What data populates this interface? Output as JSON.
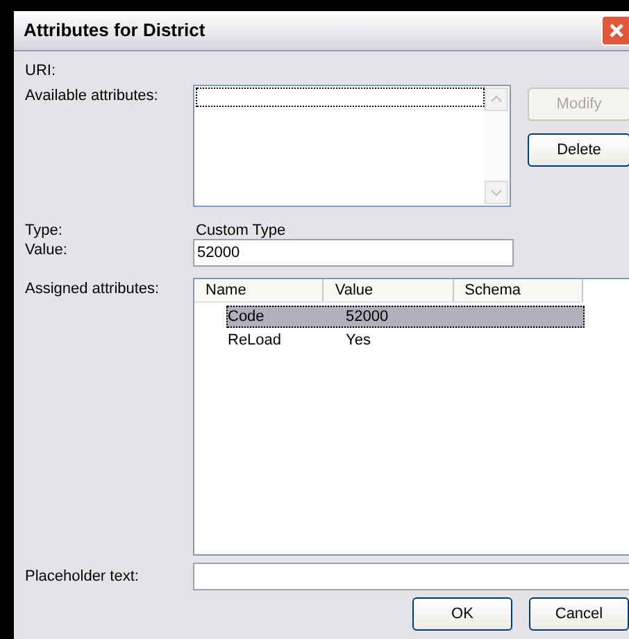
{
  "window": {
    "title": "Attributes for District"
  },
  "uri_label": "URI:",
  "available": {
    "label": "Available attributes:"
  },
  "side_buttons": [
    {
      "label": "Modify",
      "disabled": true
    },
    {
      "label": "Delete",
      "disabled": false
    }
  ],
  "type": {
    "label": "Type:",
    "value": "Custom Type"
  },
  "value": {
    "label": "Value:",
    "value": "52000"
  },
  "assigned": {
    "label": "Assigned attributes:",
    "columns": [
      "Name",
      "Value",
      "Schema"
    ],
    "rows": [
      {
        "cells": [
          "Code",
          "52000"
        ],
        "selected": true
      },
      {
        "cells": [
          "ReLoad",
          "Yes"
        ],
        "selected": false
      }
    ]
  },
  "placeholder_field": {
    "label": "Placeholder text:"
  },
  "buttons": [
    "OK",
    "Cancel"
  ]
}
